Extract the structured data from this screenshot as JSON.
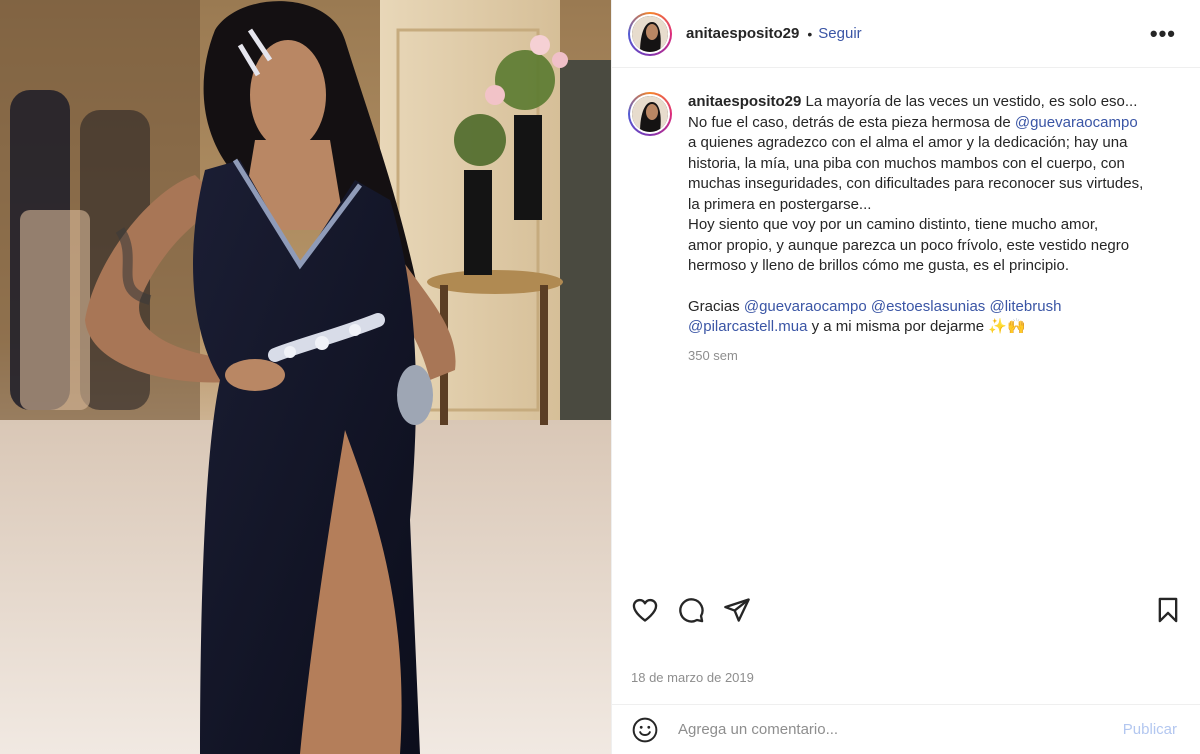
{
  "post": {
    "username": "anitaesposito29",
    "separator": "•",
    "follow_label": "Seguir",
    "more_label": "•••"
  },
  "caption": {
    "username": "anitaesposito29",
    "line1": "La mayoría de las veces un vestido, es solo eso...",
    "line2_pre": "No fue el caso, detrás de esta pieza hermosa de ",
    "line2_mention": "@guevaraocampo",
    "line3": "a quienes agradezco con el alma el amor y la dedicación; hay una",
    "line4": "historia, la mía, una piba con muchos mambos con el cuerpo, con",
    "line5": "muchas inseguridades, con dificultades para reconocer sus virtudes,",
    "line6": "la primera en postergarse...",
    "line7": "Hoy siento que voy por un camino distinto, tiene mucho amor,",
    "line8": "amor propio, y aunque parezca un poco frívolo, este vestido negro",
    "line9": "hermoso y lleno de brillos cómo me gusta, es el principio.",
    "thanks_label": "Gracias",
    "mention1": "@guevaraocampo",
    "mention2": "@estoeslasunias",
    "mention3": "@litebrush",
    "mention4": "@pilarcastell.mua",
    "thanks_tail": " y a mi misma por dejarme ✨🙌",
    "time_ago": "350 sem"
  },
  "actions": {
    "like_icon": "heart-icon",
    "comment_icon": "comment-icon",
    "share_icon": "paper-plane-icon",
    "save_icon": "bookmark-icon"
  },
  "date": "18 de marzo de 2019",
  "comment_box": {
    "placeholder": "Agrega un comentario...",
    "publish_label": "Publicar"
  },
  "colors": {
    "link": "#3a55a5",
    "muted": "#8e8e8e",
    "publish_disabled": "#b3c7f0",
    "text": "#262626"
  }
}
